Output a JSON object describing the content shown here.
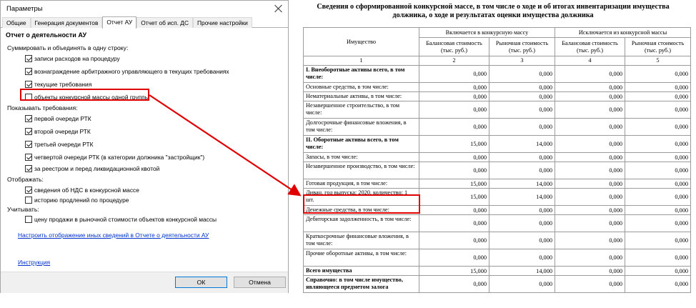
{
  "dialog": {
    "title": "Параметры",
    "tabs": [
      {
        "label": "Общие"
      },
      {
        "label": "Генерация документов"
      },
      {
        "label": "Отчет АУ"
      },
      {
        "label": "Отчет об исп. ДС"
      },
      {
        "label": "Прочие настройки"
      }
    ],
    "section_header": "Отчет о деятельности АУ",
    "group1_label": "Суммировать и объединять в одну строку:",
    "group1": [
      {
        "label": "записи расходов на процедуру",
        "checked": true
      },
      {
        "label": "вознаграждение арбитражного управляющего в текущих требованиях",
        "checked": true
      },
      {
        "label": "текущие требования",
        "checked": true
      },
      {
        "label": "объекты конкурсной массы одной группы",
        "checked": false
      }
    ],
    "group2_label": "Показывать требования:",
    "group2": [
      {
        "label": "первой очереди РТК",
        "checked": true
      },
      {
        "label": "второй очереди РТК",
        "checked": true
      },
      {
        "label": "третьей очереди РТК",
        "checked": true
      },
      {
        "label": "четвертой очереди РТК (в категории должника \"застройщик\")",
        "checked": true
      },
      {
        "label": "за реестром и перед ликвидационной квотой",
        "checked": true
      }
    ],
    "group3_label": "Отображать:",
    "group3": [
      {
        "label": "сведения об НДС в конкурсной массе",
        "checked": true
      },
      {
        "label": "историю продлений по процедуре",
        "checked": false
      }
    ],
    "group4_label": "Учитывать:",
    "group4": [
      {
        "label": "цену продажи в рыночной стоимости объектов конкурсной массы",
        "checked": false
      }
    ],
    "settings_link": "Настроить отображение иных сведений в Отчете о деятельности АУ",
    "instruction_link": "Инструкция",
    "ok_label": "ОК",
    "cancel_label": "Отмена"
  },
  "report": {
    "title_line1": "Сведения о сформированной конкурсной массе, в том числе о ходе и об итогах инвентаризации имущества",
    "title_line2": "должника, о ходе и результатах оценки имущества должника",
    "header": {
      "property": "Имущество",
      "included": "Включается в конкурсную массу",
      "excluded": "Исключается из конкурсной массы",
      "balance": "Балансовая стоимость (тыс. руб.)",
      "market": "Рыночная стоимость (тыс. руб.)",
      "col_numbers": [
        "1",
        "2",
        "3",
        "4",
        "5"
      ]
    },
    "rows": [
      {
        "name": "I. Внеоборотные активы всего, в том числе:",
        "bold": true,
        "values": [
          "0,000",
          "0,000",
          "0,000",
          "0,000"
        ]
      },
      {
        "name": "Основные средства, в том числе:",
        "bold": false,
        "values": [
          "0,000",
          "0,000",
          "0,000",
          "0,000"
        ]
      },
      {
        "name": "Нематериальные активы, в том числе:",
        "bold": false,
        "values": [
          "0,000",
          "0,000",
          "0,000",
          "0,000"
        ]
      },
      {
        "name": "Незавершенное строительство, в том числе:",
        "bold": false,
        "values": [
          "0,000",
          "0,000",
          "0,000",
          "0,000"
        ]
      },
      {
        "name": "Долгосрочные финансовые вложения, в том числе:",
        "bold": false,
        "values": [
          "0,000",
          "0,000",
          "0,000",
          "0,000"
        ]
      },
      {
        "name": "II. Оборотные активы всего, в том числе:",
        "bold": true,
        "values": [
          "15,000",
          "14,000",
          "0,000",
          "0,000"
        ]
      },
      {
        "name": "Запасы, в том числе:",
        "bold": false,
        "values": [
          "0,000",
          "0,000",
          "0,000",
          "0,000"
        ]
      },
      {
        "name": "Незавершенное производство, в том числе:",
        "bold": false,
        "values": [
          "0,000",
          "0,000",
          "0,000",
          "0,000"
        ]
      },
      {
        "name": "Готовая продукция, в том числе:",
        "bold": false,
        "values": [
          "15,000",
          "14,000",
          "0,000",
          "0,000"
        ]
      },
      {
        "name": "Диван, год выпуска: 2020, количество: 1 шт.",
        "bold": false,
        "values": [
          "15,000",
          "14,000",
          "0,000",
          "0,000"
        ]
      },
      {
        "name": "Денежные средства, в том числе:",
        "bold": false,
        "values": [
          "0,000",
          "0,000",
          "0,000",
          "0,000"
        ]
      },
      {
        "name": "Дебиторская задолженность, в том числе:",
        "bold": false,
        "values": [
          "0,000",
          "0,000",
          "0,000",
          "0,000"
        ]
      },
      {
        "name": "Краткосрочные финансовые вложения, в том числе:",
        "bold": false,
        "values": [
          "0,000",
          "0,000",
          "0,000",
          "0,000"
        ]
      },
      {
        "name": "Прочие оборотные активы, в том числе:",
        "bold": false,
        "values": [
          "0,000",
          "0,000",
          "0,000",
          "0,000"
        ]
      },
      {
        "name": "Всего имущества",
        "bold": true,
        "values": [
          "15,000",
          "14,000",
          "0,000",
          "0,000"
        ]
      },
      {
        "name": "Справочно: в том числе имущество, являющееся предметом залога",
        "bold": true,
        "values": [
          "0,000",
          "0,000",
          "0,000",
          "0,000"
        ]
      }
    ]
  },
  "colors": {
    "highlight": "#e00000",
    "link": "#0033cc"
  }
}
